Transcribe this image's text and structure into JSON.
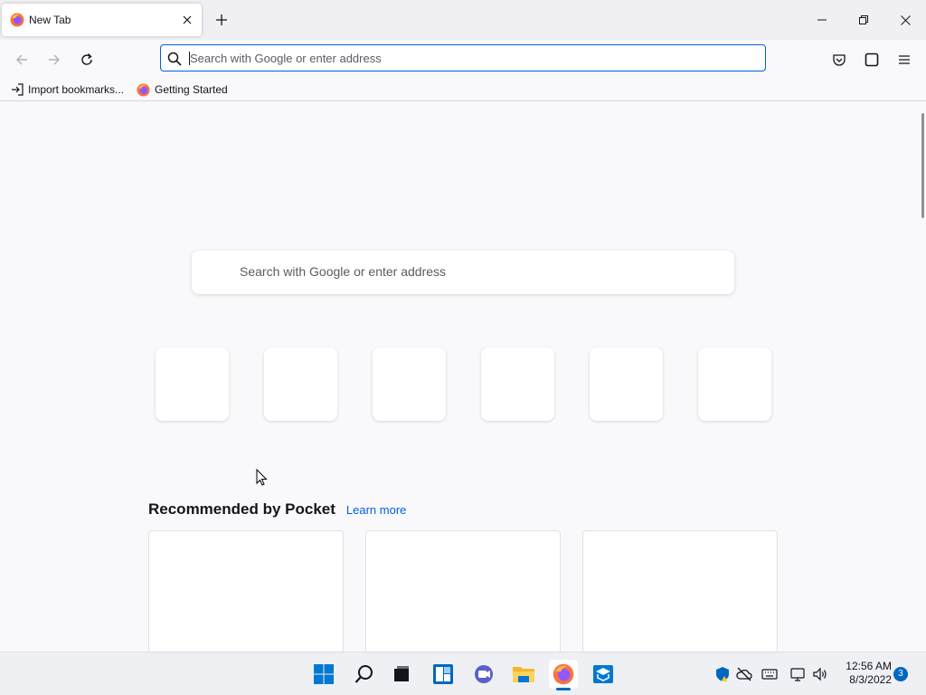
{
  "tab": {
    "title": "New Tab",
    "favicon": "firefox-icon"
  },
  "urlbar": {
    "placeholder": "Search with Google or enter address",
    "value": ""
  },
  "bookmarks": [
    {
      "label": "Import bookmarks...",
      "icon": "import-icon"
    },
    {
      "label": "Getting Started",
      "icon": "firefox-icon"
    }
  ],
  "newtab": {
    "search_placeholder": "Search with Google or enter address",
    "top_sites_count": 6,
    "pocket": {
      "title": "Recommended by Pocket",
      "learn_more": "Learn more"
    }
  },
  "taskbar": {
    "apps": [
      "start-icon",
      "search-icon",
      "task-view-icon",
      "widgets-icon",
      "chat-icon",
      "file-explorer-icon",
      "firefox-icon",
      "store-icon"
    ],
    "active_app": "firefox-icon",
    "clock": {
      "time": "12:56 AM",
      "date": "8/3/2022"
    },
    "notifications": "3"
  },
  "colors": {
    "accent": "#0060df",
    "taskbar_accent": "#0067c0"
  }
}
